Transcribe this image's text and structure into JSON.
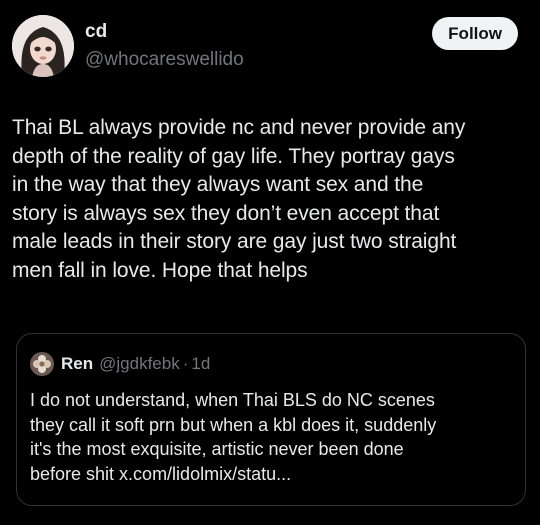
{
  "colors": {
    "background": "#000000",
    "primary_text": "#e7e9ea",
    "secondary_text": "#71767b",
    "follow_bg": "#eff3f4",
    "follow_text": "#0f1419",
    "card_border": "#2f3336"
  },
  "author": {
    "display_name": "cd",
    "handle": "@whocareswellido",
    "avatar_icon": "doll-avatar"
  },
  "follow": {
    "label": "Follow"
  },
  "post": {
    "lines": [
      "Thai BL always provide nc  and never provide any",
      "depth of the reality of gay life. They portray gays",
      "in the way that they always want sex and the",
      "story is always sex they don’t even accept that",
      "male leads in their story are gay just two straight",
      "men fall in love. Hope that helps"
    ]
  },
  "quote": {
    "avatar_icon": "flower-avatar",
    "name": "Ren",
    "handle": "@jgdkfebk",
    "separator": "·",
    "time": "1d",
    "lines": [
      "I do not understand, when Thai BLS do NC scenes",
      "they call it soft prn but when a kbl does it, suddenly",
      "it's the most exquisite, artistic never been done",
      "before shit x.com/lidolmix/statu..."
    ]
  }
}
